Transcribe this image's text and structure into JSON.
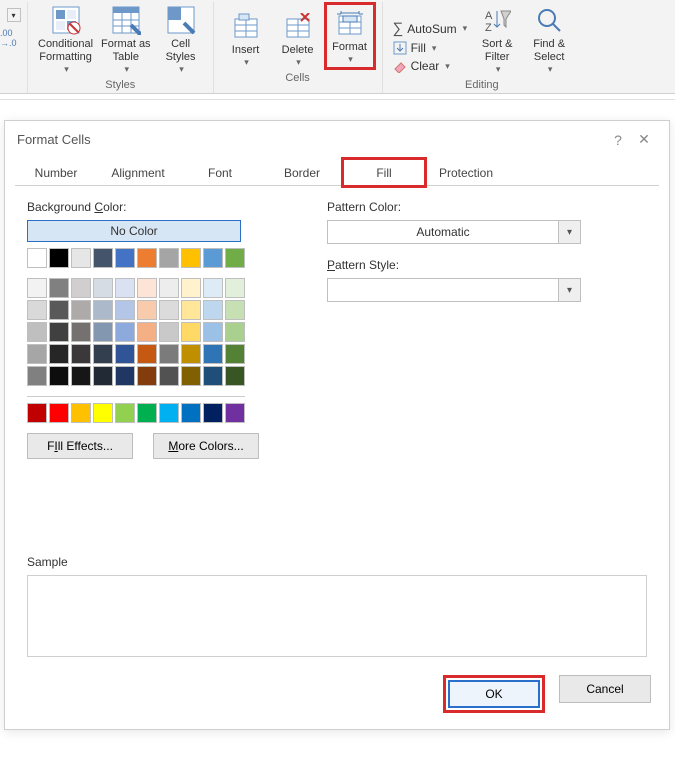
{
  "ribbon": {
    "decimal_label": ".00\n→.0",
    "styles": {
      "conditional": "Conditional\nFormatting",
      "format_as_table": "Format as\nTable",
      "cell_styles": "Cell\nStyles",
      "group_label": "Styles"
    },
    "cells": {
      "insert": "Insert",
      "delete": "Delete",
      "format": "Format",
      "group_label": "Cells"
    },
    "editing": {
      "autosum": "AutoSum",
      "fill": "Fill",
      "clear": "Clear",
      "sort_filter": "Sort &\nFilter",
      "find_select": "Find &\nSelect",
      "group_label": "Editing"
    }
  },
  "dialog": {
    "title": "Format Cells",
    "help": "?",
    "close": "✕",
    "tabs": {
      "number": "Number",
      "alignment": "Alignment",
      "font": "Font",
      "border": "Border",
      "fill": "Fill",
      "protection": "Protection"
    },
    "bg_label_pre": "Background ",
    "bg_label_u": "C",
    "bg_label_post": "olor:",
    "no_color": "No Color",
    "fill_effects_u": "I",
    "fill_effects_pre": "Fill Effects...",
    "more_colors_u": "M",
    "more_colors": "ore Colors...",
    "pattern_color_u": "A",
    "pattern_color_pre": "Pattern Color:",
    "automatic": "Automatic",
    "pattern_style_u": "P",
    "pattern_style": "attern Style:",
    "sample": "Sample",
    "ok": "OK",
    "cancel": "Cancel"
  },
  "palettes": {
    "row1": [
      "#ffffff",
      "#000000",
      "#e7e6e6",
      "#44546a",
      "#4472c4",
      "#ed7d31",
      "#a5a5a5",
      "#ffc000",
      "#5b9bd5",
      "#70ad47"
    ],
    "shades": [
      [
        "#f2f2f2",
        "#808080",
        "#d0cece",
        "#d6dce4",
        "#d9e1f2",
        "#fce4d6",
        "#ededed",
        "#fff2cc",
        "#ddebf7",
        "#e2efda"
      ],
      [
        "#d9d9d9",
        "#595959",
        "#aeaaaa",
        "#acb9ca",
        "#b4c6e7",
        "#f8cbad",
        "#dbdbdb",
        "#ffe699",
        "#bdd7ee",
        "#c6e0b4"
      ],
      [
        "#bfbfbf",
        "#404040",
        "#757171",
        "#8497b0",
        "#8ea9db",
        "#f4b084",
        "#c9c9c9",
        "#ffd966",
        "#9bc2e6",
        "#a9d08e"
      ],
      [
        "#a6a6a6",
        "#262626",
        "#3a3838",
        "#333f4f",
        "#305496",
        "#c65911",
        "#7b7b7b",
        "#bf8f00",
        "#2f75b5",
        "#548235"
      ],
      [
        "#808080",
        "#0d0d0d",
        "#161616",
        "#222b35",
        "#203764",
        "#833c0c",
        "#525252",
        "#806000",
        "#1f4e78",
        "#375623"
      ]
    ],
    "standard": [
      "#c00000",
      "#ff0000",
      "#ffc000",
      "#ffff00",
      "#92d050",
      "#00b050",
      "#00b0f0",
      "#0070c0",
      "#002060",
      "#7030a0"
    ]
  }
}
